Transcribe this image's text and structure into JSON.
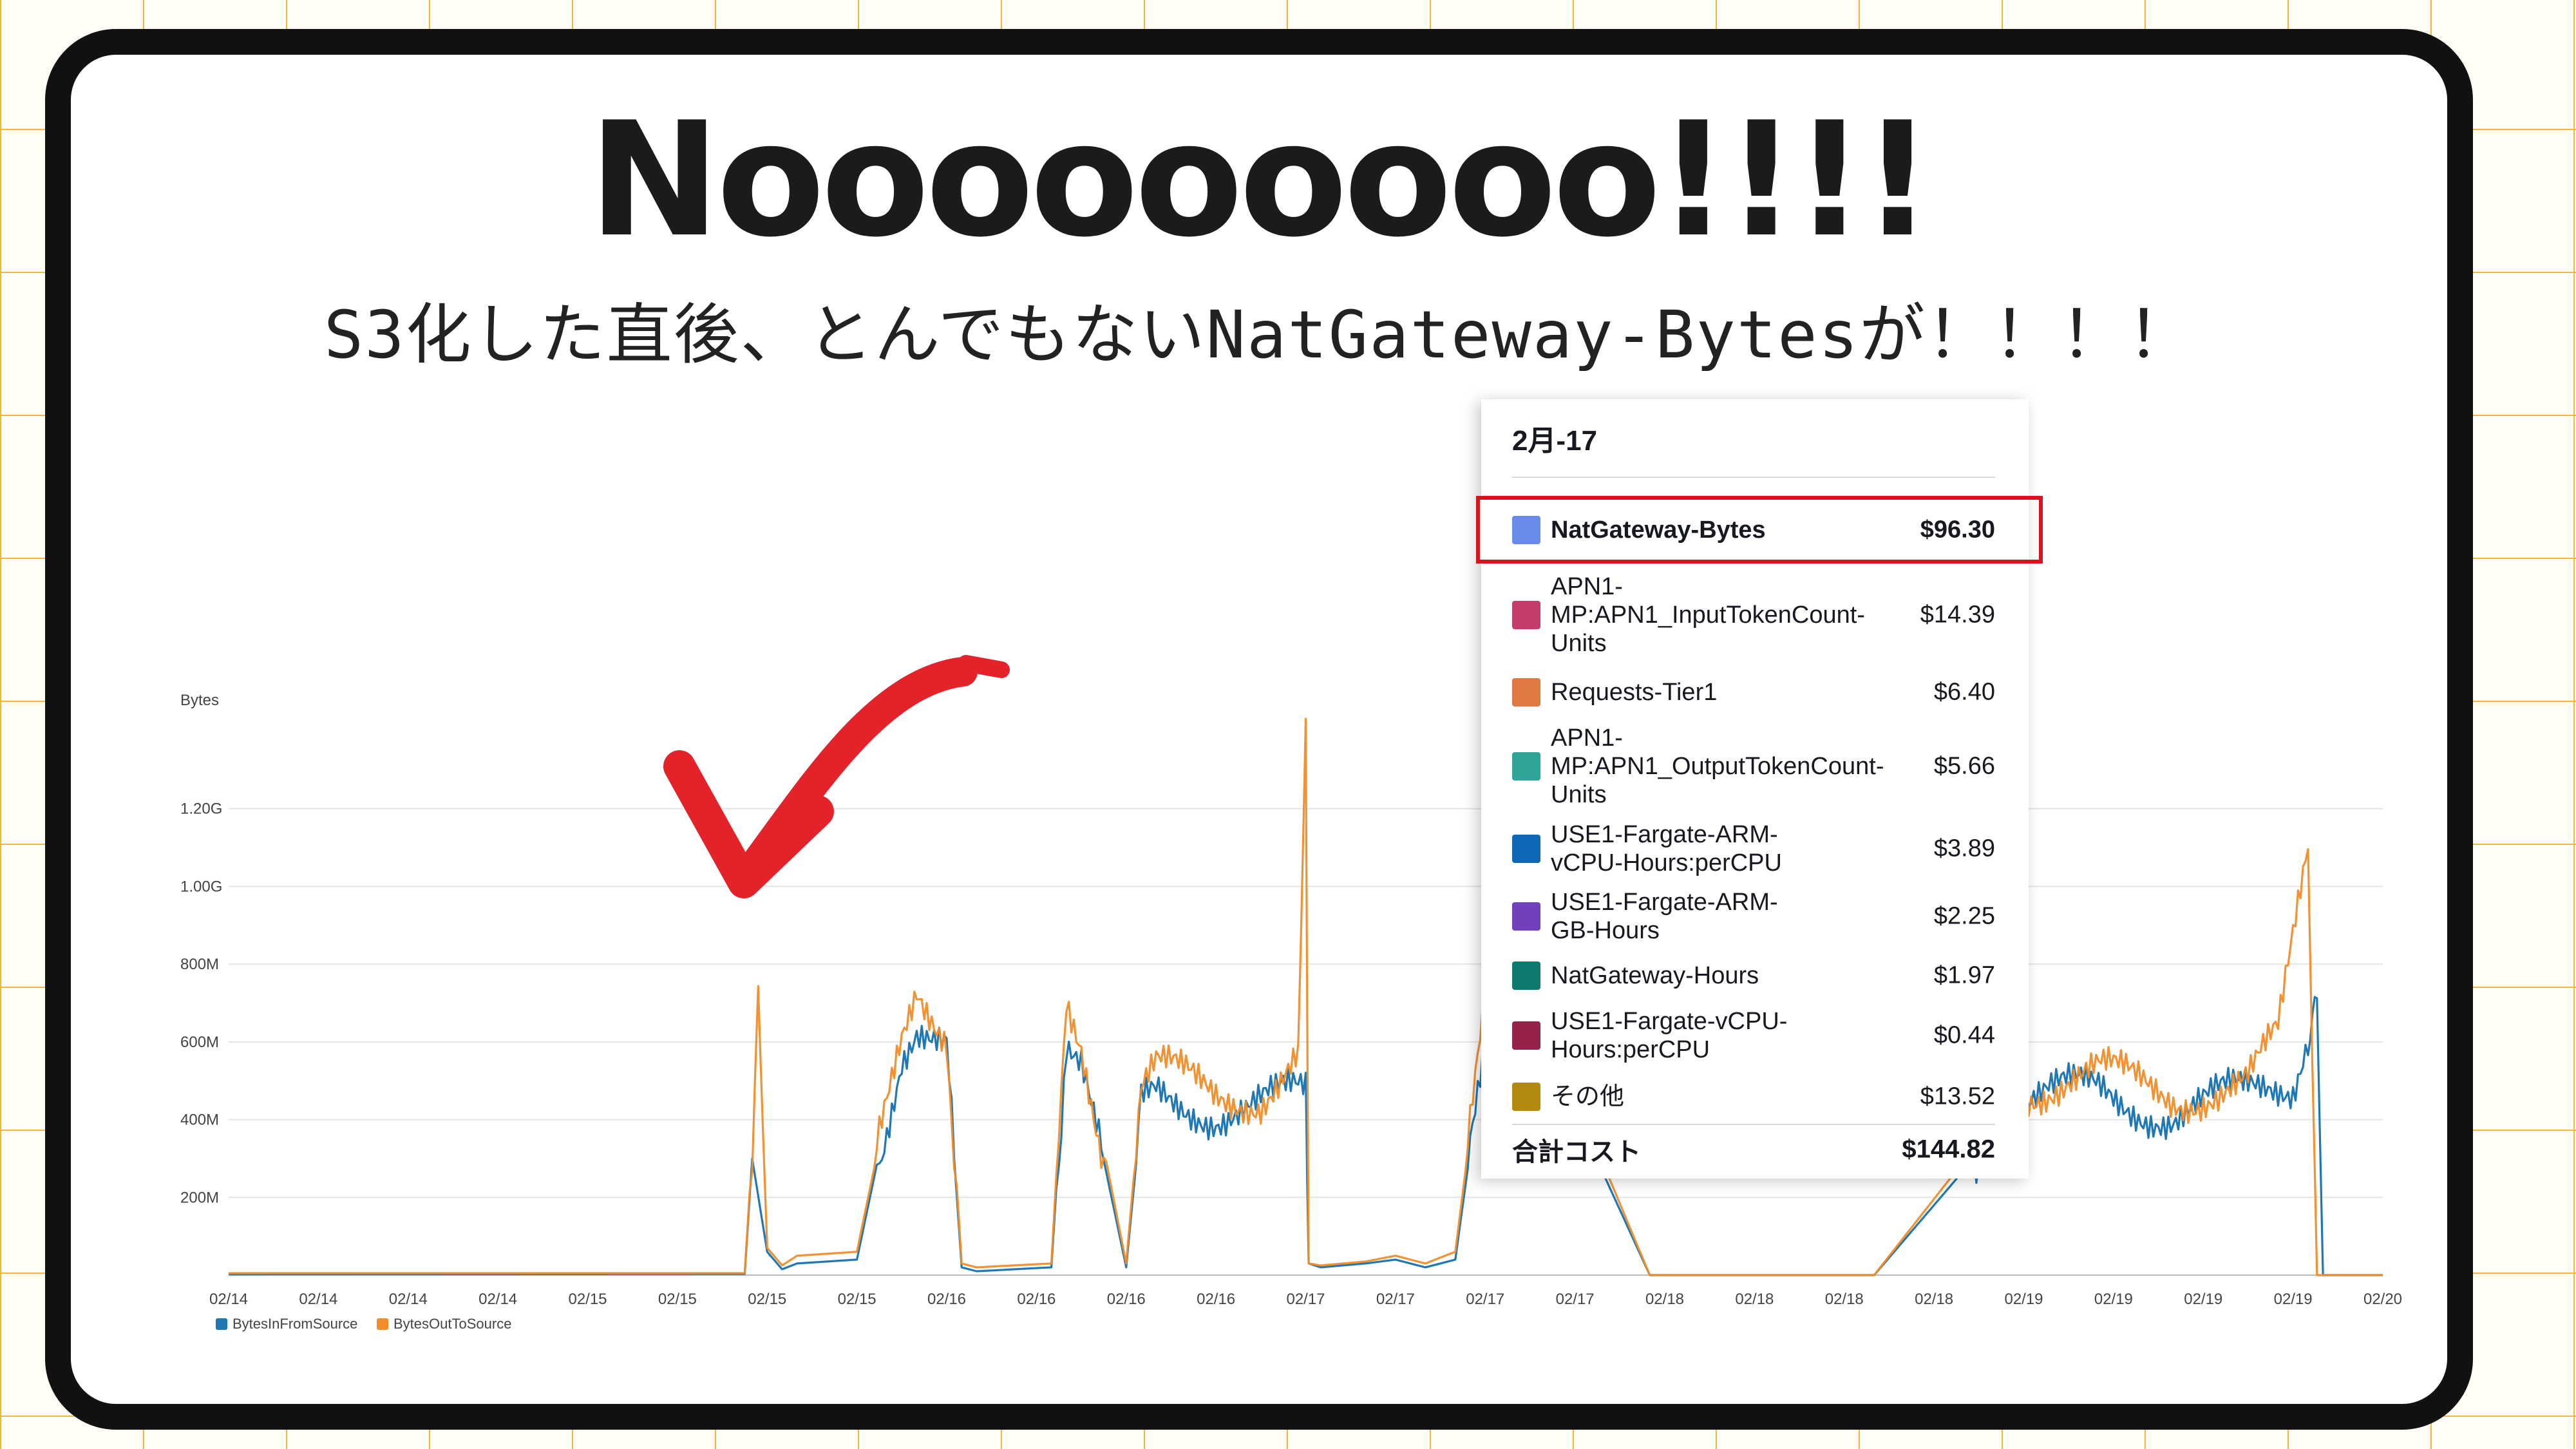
{
  "headline": "Nooooooooo!!!!",
  "subtitle": "S3化した直後、とんでもないNatGateway-Bytesが！！！！",
  "colors": {
    "bytes_in": "#1f77b4",
    "bytes_out": "#f28c28",
    "highlight": "#d8131d",
    "arrow": "#e3222a"
  },
  "chart_data": {
    "type": "line",
    "ylabel": "Bytes",
    "y_ticks": [
      "200M",
      "400M",
      "600M",
      "800M",
      "1.00G",
      "1.20G"
    ],
    "y_tick_values": [
      200,
      400,
      600,
      800,
      1000,
      1200
    ],
    "ylim": [
      0,
      1400
    ],
    "x_ticks": [
      "02/14",
      "02/14",
      "02/14",
      "02/14",
      "02/15",
      "02/15",
      "02/15",
      "02/15",
      "02/16",
      "02/16",
      "02/16",
      "02/16",
      "02/17",
      "02/17",
      "02/17",
      "02/17",
      "02/18",
      "02/18",
      "02/18",
      "02/18",
      "02/19",
      "02/19",
      "02/19",
      "02/19",
      "02/20"
    ],
    "x_tick_values": [
      0,
      6,
      12,
      18,
      24,
      30,
      36,
      42,
      48,
      54,
      60,
      66,
      72,
      78,
      84,
      90,
      96,
      102,
      108,
      114,
      120,
      126,
      132,
      138,
      144
    ],
    "grid": true,
    "legend_position": "bottom-left",
    "series": [
      {
        "name": "BytesInFromSource",
        "x": [
          0,
          34.5,
          35,
          36,
          37,
          38,
          42,
          45,
          46,
          48,
          49,
          50,
          55,
          56,
          57,
          60,
          61,
          62,
          66,
          69,
          72,
          72.2,
          73,
          76,
          78,
          80,
          82,
          84,
          86,
          88,
          90,
          95,
          100,
          110,
          120,
          125,
          130,
          135,
          138,
          139,
          139.6,
          140,
          142,
          144
        ],
        "y": [
          2,
          3,
          300,
          60,
          15,
          30,
          40,
          590,
          650,
          580,
          20,
          10,
          20,
          630,
          570,
          20,
          420,
          460,
          430,
          440,
          450,
          30,
          20,
          30,
          40,
          20,
          40,
          600,
          450,
          400,
          420,
          0,
          0,
          0,
          450,
          470,
          420,
          460,
          500,
          650,
          660,
          0,
          0,
          0
        ]
      },
      {
        "name": "BytesOutToSource",
        "x": [
          0,
          34.5,
          35,
          35.4,
          36,
          37,
          38,
          42,
          45,
          46,
          48,
          49,
          50,
          55,
          56,
          57,
          60,
          61,
          62,
          66,
          69,
          71.5,
          72,
          72.2,
          73,
          76,
          78,
          80,
          82,
          84,
          86,
          88,
          90,
          95,
          100,
          110,
          120,
          125,
          130,
          135,
          137,
          138,
          139,
          139.6,
          140,
          142,
          144
        ],
        "y": [
          5,
          5,
          320,
          700,
          70,
          25,
          50,
          60,
          620,
          760,
          640,
          30,
          20,
          30,
          720,
          620,
          30,
          470,
          520,
          470,
          470,
          560,
          1380,
          30,
          25,
          35,
          50,
          30,
          60,
          670,
          500,
          450,
          460,
          0,
          0,
          0,
          490,
          510,
          470,
          490,
          600,
          850,
          1100,
          0,
          0,
          0,
          0
        ]
      }
    ]
  },
  "tooltip": {
    "title": "2月-17",
    "rows": [
      {
        "color": "#688ae8",
        "label": "NatGateway-Bytes",
        "value": "$96.30"
      },
      {
        "color": "#c33d69",
        "label": "APN1-MP:APN1_InputTokenCount-Units",
        "value": "$14.39"
      },
      {
        "color": "#e07941",
        "label": "Requests-Tier1",
        "value": "$6.40"
      },
      {
        "color": "#2ea597",
        "label": "APN1-MP:APN1_OutputTokenCount-Units",
        "value": "$5.66"
      },
      {
        "color": "#0f68b7",
        "label": "USE1-Fargate-ARM-vCPU-Hours:perCPU",
        "value": "$3.89"
      },
      {
        "color": "#7040bd",
        "label": "USE1-Fargate-ARM-GB-Hours",
        "value": "$2.25"
      },
      {
        "color": "#0e7a6d",
        "label": "NatGateway-Hours",
        "value": "$1.97"
      },
      {
        "color": "#962249",
        "label": "USE1-Fargate-vCPU-Hours:perCPU",
        "value": "$0.44"
      },
      {
        "color": "#b28a10",
        "label": "その他",
        "value": "$13.52"
      }
    ],
    "total_label": "合計コスト",
    "total_value": "$144.82"
  }
}
